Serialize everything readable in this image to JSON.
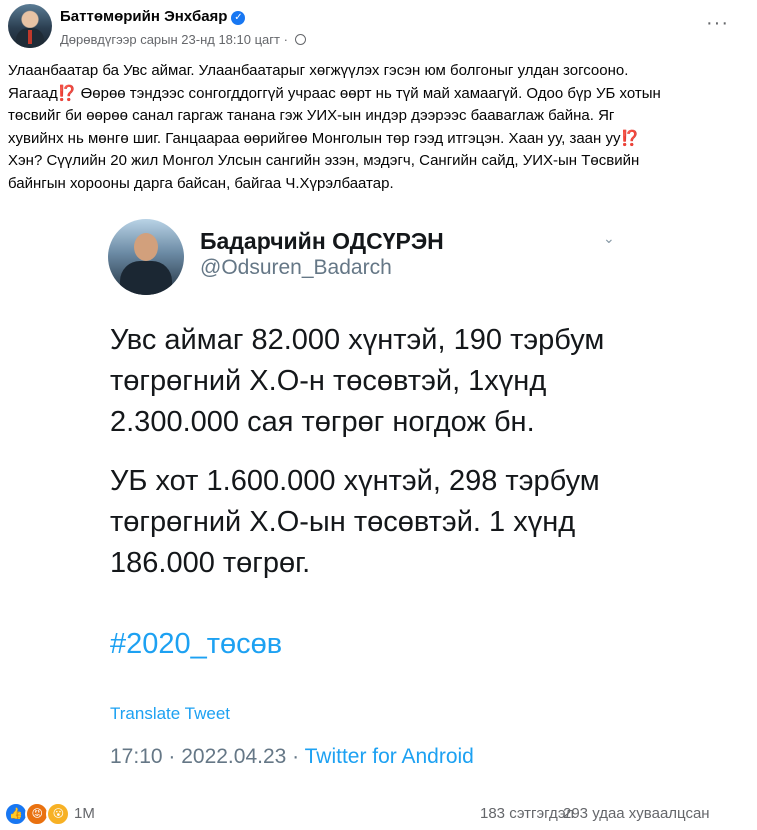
{
  "post": {
    "author": "Баттөмөрийн Энхбаяр",
    "timestamp": "Дөрөвдүгээр сарын 23-нд 18:10 цагт",
    "meta_separator": "·",
    "more_label": "···",
    "text_lines": [
      "Улаанбаатар ба Увс аймаг. Улаанбаатарыг хөгжүүлэх гэсэн юм болгоныг улдан зогсооно.",
      "Яагаад⁉️ Өөрөө тэндээс сонгогддоггүй учраас өөрт нь түй май хамаагүй. Одоо бүр УБ хотын",
      "төсвийг би өөрөө санал гаргаж танана гэж УИХ-ын индэр дээрээс баавarлаж байна. Яг",
      "хувийнх нь мөнгө шиг. Ганцаараа өөрийгөө Монголын төр гээд итгэцэн. Хаан уу, заан уу⁉️",
      "Хэн? Сүүлийн 20 жил Монгол Улсын сангийн эзэн, мэдэгч, Сангийн сайд, УИХ-ын Төсвийн",
      "байнгын хорооны дарга байсан, байгаа Ч.Хүрэлбаатар."
    ]
  },
  "tweet": {
    "name": "Бадарчийн ОДСҮРЭН",
    "handle": "@Odsuren_Badarch",
    "paragraph_1": "Увс аймаг 82.000 хүнтэй, 190 тэрбум төгрөгний Х.О-н төсөвтэй, 1хүнд 2.300.000 сая төгрөг ногдож бн.",
    "paragraph_2": "УБ хот 1.600.000 хүнтэй, 298 тэрбум төгрөгний Х.О-ын төсөвтэй. 1 хүнд 186.000 төгрөг.",
    "hashtag": "#2020_төсөв",
    "translate": "Translate Tweet",
    "time_date": "17:10 · 2022.04.23 · ",
    "client": "Twitter for Android"
  },
  "footer": {
    "reaction_count": "1M",
    "comments": "183 сэтгэгдэл",
    "shares": "293 удаа хуваалцсан"
  },
  "colors": {
    "link_blue": "#1da1f2",
    "fb_blue": "#1877f2",
    "muted": "#65676b"
  }
}
